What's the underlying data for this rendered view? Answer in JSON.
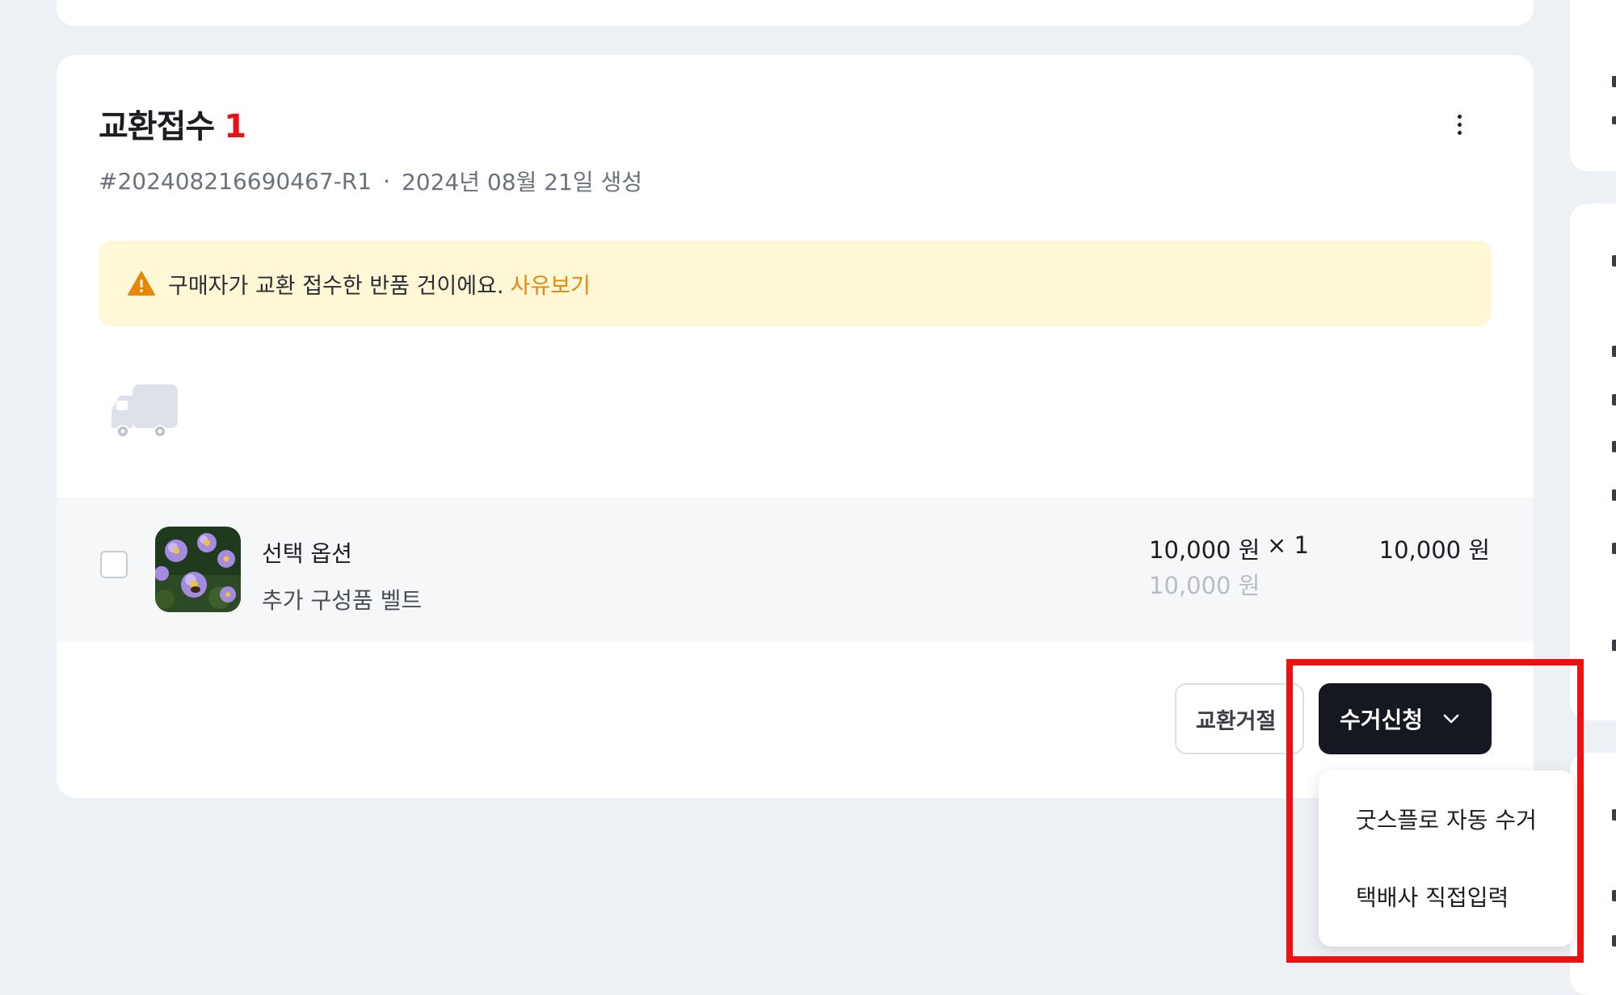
{
  "card": {
    "title": "교환접수",
    "count": "1",
    "order_id": "#202408216690467-R1",
    "separator": "·",
    "created": "2024년 08월 21일 생성"
  },
  "notice": {
    "text": "구매자가 교환 접수한 반품 건이에요.",
    "link": "사유보기",
    "icon": "warning-icon"
  },
  "product": {
    "option_name": "선택 옵션",
    "option_sub": "추가 구성품 벨트",
    "unit_price": "10,000 원",
    "quantity": "× 1",
    "original_price": "10,000 원",
    "total_price": "10,000 원",
    "checked": false
  },
  "actions": {
    "reject_label": "교환거절",
    "pickup_label": "수거신청"
  },
  "dropdown": {
    "items": [
      {
        "label": "굿스플로 자동 수거"
      },
      {
        "label": "택배사 직접입력"
      }
    ]
  },
  "colors": {
    "accent_red": "#e41515",
    "notice_bg": "#fef8d6",
    "link_orange": "#e8860a",
    "primary_button": "#151820",
    "highlight": "#ee1111"
  }
}
